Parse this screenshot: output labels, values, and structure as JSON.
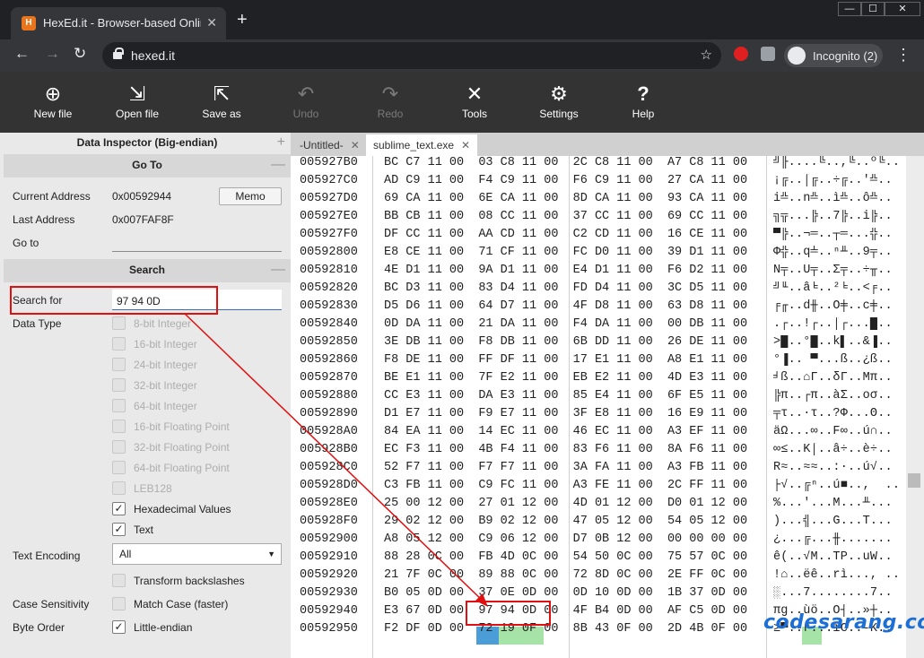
{
  "browser": {
    "tab_title": "HexEd.it - Browser-based Online",
    "favicon": "H",
    "url": "hexed.it",
    "profile": "Incognito (2)",
    "window_controls": [
      "—",
      "☐",
      "✕"
    ]
  },
  "toolbar": {
    "new_file": "New file",
    "open_file": "Open file",
    "save_as": "Save as",
    "undo": "Undo",
    "redo": "Redo",
    "tools": "Tools",
    "settings": "Settings",
    "help": "Help"
  },
  "inspector": {
    "title": "Data Inspector (Big-endian)",
    "goto_title": "Go To",
    "current_address_label": "Current Address",
    "current_address": "0x00592944",
    "memo": "Memo",
    "last_address_label": "Last Address",
    "last_address": "0x007FAF8F",
    "goto_label": "Go to",
    "search_title": "Search",
    "search_for_label": "Search for",
    "search_value": "97 94 0D",
    "data_type_label": "Data Type",
    "data_types": [
      {
        "label": "8-bit Integer",
        "checked": false,
        "disabled": true
      },
      {
        "label": "16-bit Integer",
        "checked": false,
        "disabled": true
      },
      {
        "label": "24-bit Integer",
        "checked": false,
        "disabled": true
      },
      {
        "label": "32-bit Integer",
        "checked": false,
        "disabled": true
      },
      {
        "label": "64-bit Integer",
        "checked": false,
        "disabled": true
      },
      {
        "label": "16-bit Floating Point",
        "checked": false,
        "disabled": true
      },
      {
        "label": "32-bit Floating Point",
        "checked": false,
        "disabled": true
      },
      {
        "label": "64-bit Floating Point",
        "checked": false,
        "disabled": true
      },
      {
        "label": "LEB128",
        "checked": false,
        "disabled": true
      },
      {
        "label": "Hexadecimal Values",
        "checked": true,
        "disabled": false
      },
      {
        "label": "Text",
        "checked": true,
        "disabled": false
      }
    ],
    "text_encoding_label": "Text Encoding",
    "text_encoding": "All",
    "transform_backslashes": "Transform backslashes",
    "case_sensitivity_label": "Case Sensitivity",
    "match_case": "Match Case (faster)",
    "byte_order_label": "Byte Order",
    "little_endian": "Little-endian"
  },
  "files": {
    "tabs": [
      "-Untitled-",
      "sublime_text.exe"
    ]
  },
  "hex_rows": [
    {
      "addr": "005927B0",
      "hex": "BC C7 11 00 03 C8 11 00 2C C8 11 00 A7 C8 11 00",
      "text": "╝╟....╚..,╚..º╚.."
    },
    {
      "addr": "005927C0",
      "hex": "AD C9 11 00 F4 C9 11 00 F6 C9 11 00 27 CA 11 00",
      "text": "¡╔..⌠╔..÷╔..'╩.."
    },
    {
      "addr": "005927D0",
      "hex": "69 CA 11 00 6E CA 11 00 8D CA 11 00 93 CA 11 00",
      "text": "i╩..n╩..ì╩..ô╩.."
    },
    {
      "addr": "005927E0",
      "hex": "BB CB 11 00 08 CC 11 00 37 CC 11 00 69 CC 11 00",
      "text": "╗╦...╠..7╠..i╠.."
    },
    {
      "addr": "005927F0",
      "hex": "DF CC 11 00 AA CD 11 00 C2 CD 11 00 16 CE 11 00",
      "text": "▀╠..¬═..┬═...╬.."
    },
    {
      "addr": "00592800",
      "hex": "E8 CE 11 00 71 CF 11 00 FC D0 11 00 39 D1 11 00",
      "text": "Φ╬..q╧..ⁿ╨..9╤.."
    },
    {
      "addr": "00592810",
      "hex": "4E D1 11 00 9A D1 11 00 E4 D1 11 00 F6 D2 11 00",
      "text": "N╤..Ü╤..Σ╤..÷╥.."
    },
    {
      "addr": "00592820",
      "hex": "BC D3 11 00 83 D4 11 00 FD D4 11 00 3C D5 11 00",
      "text": "╝╙..â╘..²╘..<╒.."
    },
    {
      "addr": "00592830",
      "hex": "D5 D6 11 00 64 D7 11 00 4F D8 11 00 63 D8 11 00",
      "text": "╒╓..d╫..O╪..c╪.."
    },
    {
      "addr": "00592840",
      "hex": "0D DA 11 00 21 DA 11 00 F4 DA 11 00 00 DB 11 00",
      "text": ".┌..!┌..⌠┌...█.."
    },
    {
      "addr": "00592850",
      "hex": "3E DB 11 00 F8 DB 11 00 6B DD 11 00 26 DE 11 00",
      "text": ">█..°█..k▌..&▐.."
    },
    {
      "addr": "00592860",
      "hex": "F8 DE 11 00 FF DF 11 00 17 E1 11 00 A8 E1 11 00",
      "text": "°▐.. ▀...ß..¿ß.."
    },
    {
      "addr": "00592870",
      "hex": "BE E1 11 00 7F E2 11 00 EB E2 11 00 4D E3 11 00",
      "text": "╛ß..⌂Γ..δΓ..Mπ.."
    },
    {
      "addr": "00592880",
      "hex": "CC E3 11 00 DA E3 11 00 85 E4 11 00 6F E5 11 00",
      "text": "╠π..┌π..àΣ..oσ.."
    },
    {
      "addr": "00592890",
      "hex": "D1 E7 11 00 F9 E7 11 00 3F E8 11 00 16 E9 11 00",
      "text": "╤τ..·τ..?Φ...Θ.."
    },
    {
      "addr": "005928A0",
      "hex": "84 EA 11 00 14 EC 11 00 46 EC 11 00 A3 EF 11 00",
      "text": "äΩ...∞..F∞..ú∩.."
    },
    {
      "addr": "005928B0",
      "hex": "EC F3 11 00 4B F4 11 00 83 F6 11 00 8A F6 11 00",
      "text": "∞≤..K⌠..â÷..è÷.."
    },
    {
      "addr": "005928C0",
      "hex": "52 F7 11 00 F7 F7 11 00 3A FA 11 00 A3 FB 11 00",
      "text": "R≈..≈≈..:·..ú√.."
    },
    {
      "addr": "005928D0",
      "hex": "C3 FB 11 00 C9 FC 11 00 A3 FE 11 00 2C FF 11 00",
      "text": "├√..╔ⁿ..ú■..,  .."
    },
    {
      "addr": "005928E0",
      "hex": "25 00 12 00 27 01 12 00 4D 01 12 00 D0 01 12 00",
      "text": "%...'...M...╨..."
    },
    {
      "addr": "005928F0",
      "hex": "29 02 12 00 B9 02 12 00 47 05 12 00 54 05 12 00",
      "text": ")...╣...G...T..."
    },
    {
      "addr": "00592900",
      "hex": "A8 05 12 00 C9 06 12 00 D7 0B 12 00 00 00 00 00",
      "text": "¿...╔...╫......."
    },
    {
      "addr": "00592910",
      "hex": "88 28 0C 00 FB 4D 0C 00 54 50 0C 00 75 57 0C 00",
      "text": "ê(..√M..TP..uW.."
    },
    {
      "addr": "00592920",
      "hex": "21 7F 0C 00 89 88 0C 00 72 8D 0C 00 2E FF 0C 00",
      "text": "!⌂..ëê..rì..., .."
    },
    {
      "addr": "00592930",
      "hex": "B0 05 0D 00 37 0E 0D 00 0D 10 0D 00 1B 37 0D 00",
      "text": "░...7........7.."
    },
    {
      "addr": "00592940",
      "hex": "E3 67 0D 00 97 94 0D 00 4F B4 0D 00 AF C5 0D 00",
      "text": "πg..ùö..O┤..»┼.."
    },
    {
      "addr": "00592950",
      "hex": "F2 DF 0D 00 72 19 0F 00 8B 43 0F 00 2D 4B 0F 00",
      "text": "≥▀..r...ïC..-K.."
    }
  ],
  "watermark": "codesarang.com",
  "colors": {
    "highlight_green": "#a6e3a6",
    "highlight_blue": "#4a9dd6",
    "annotation_red": "#e01010"
  }
}
